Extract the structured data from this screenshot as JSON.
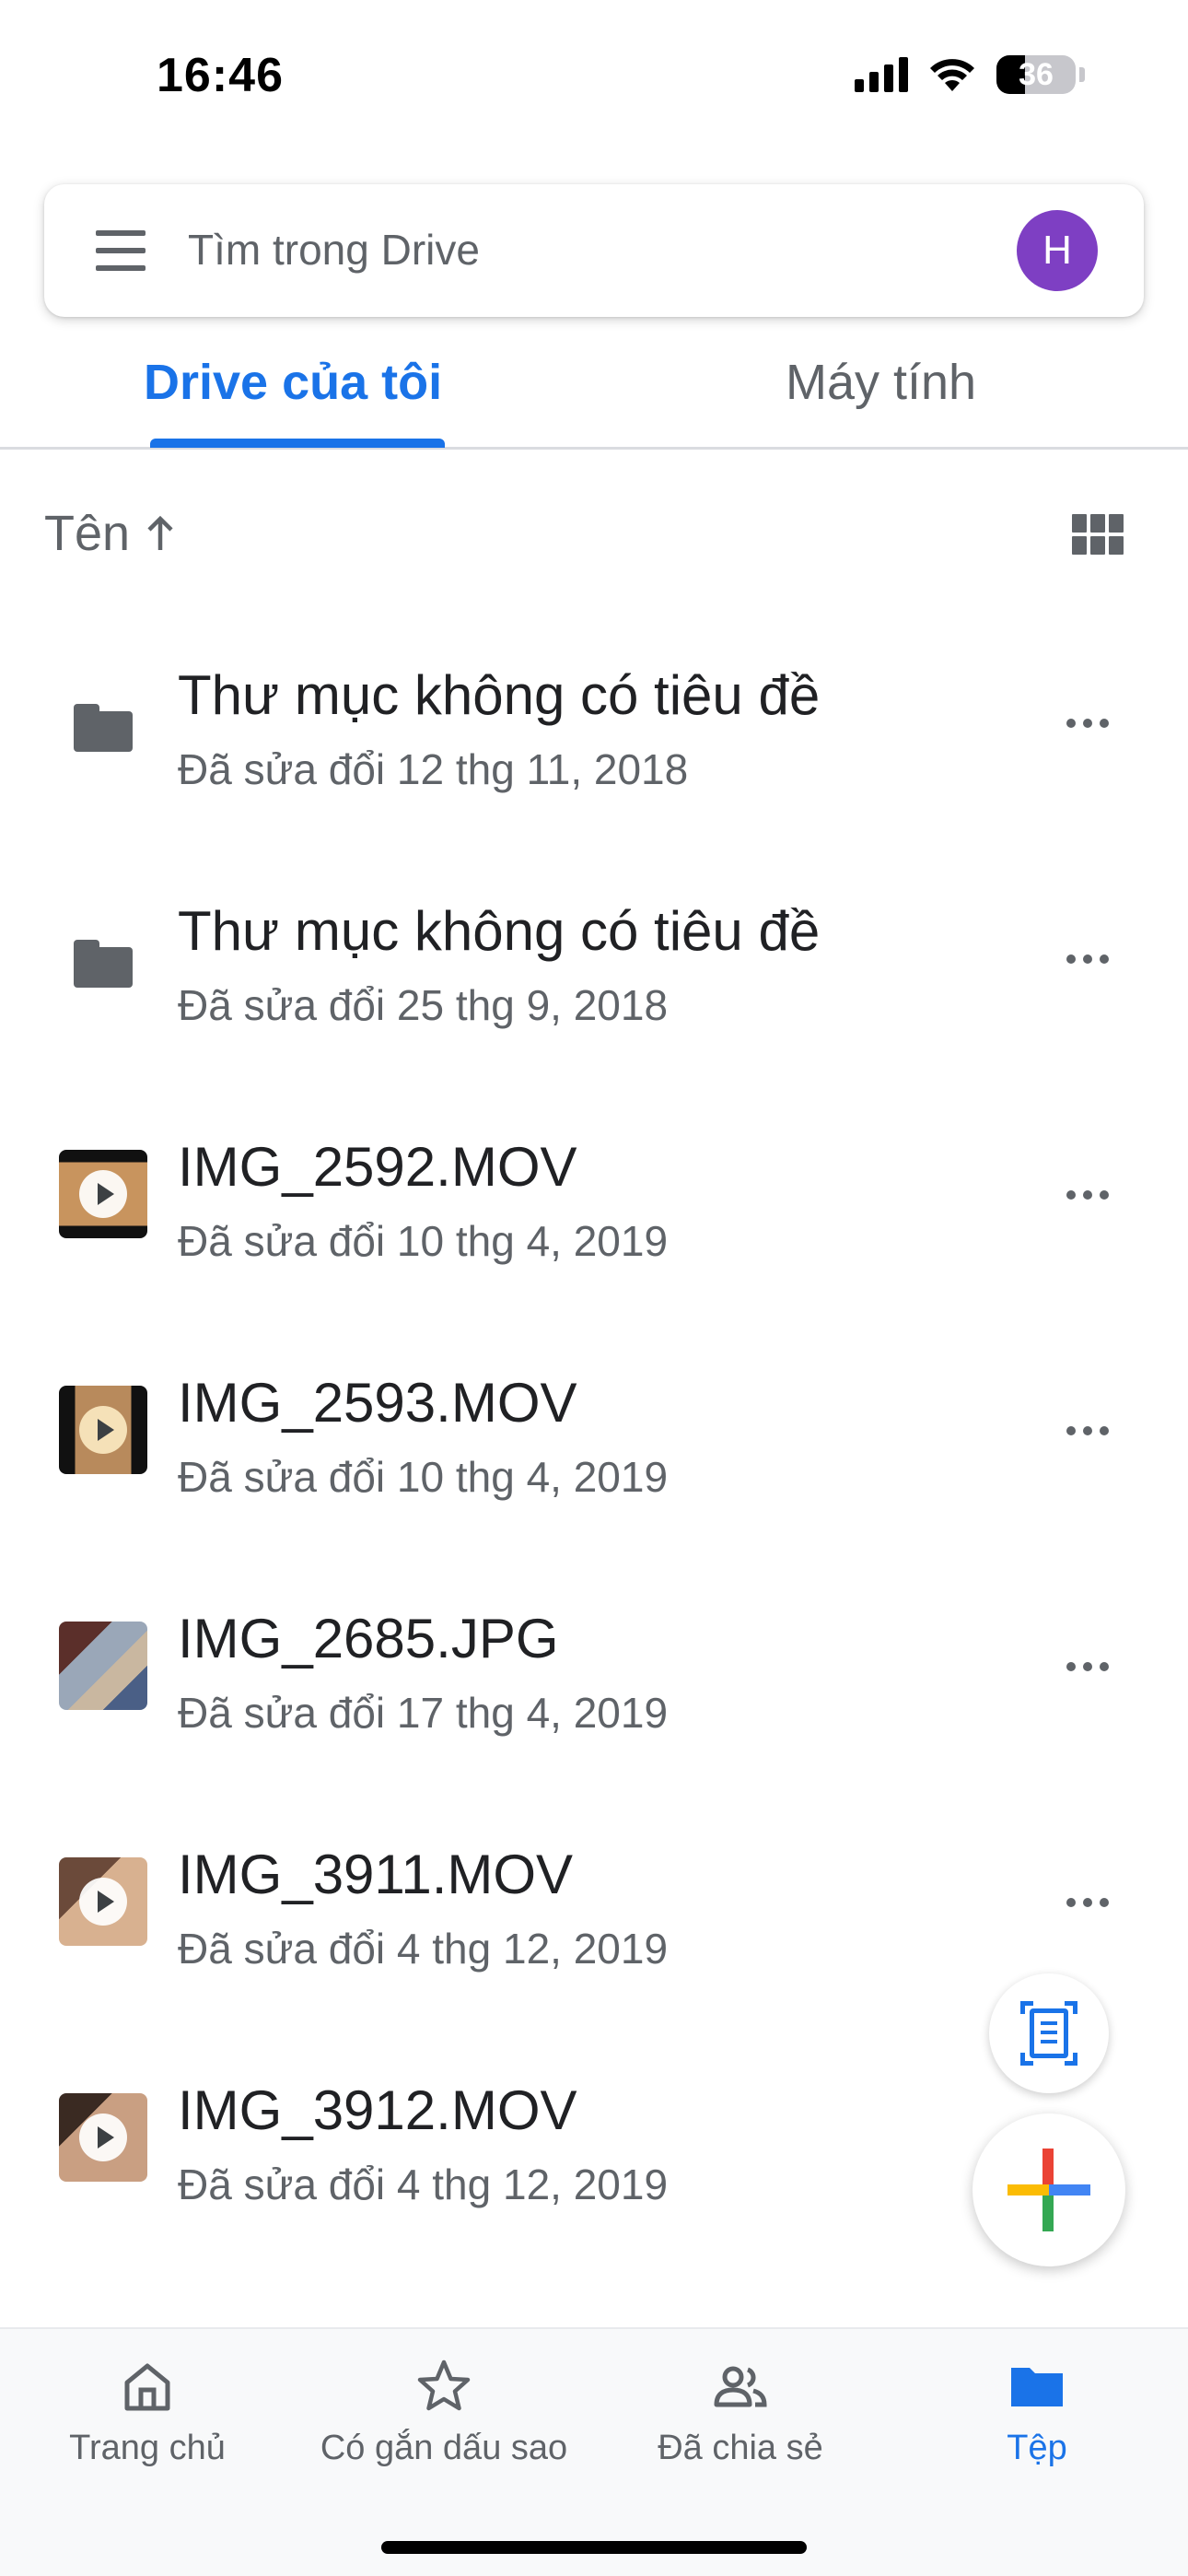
{
  "status_bar": {
    "time": "16:46",
    "battery": "36",
    "battery_level": 0.36
  },
  "search": {
    "placeholder": "Tìm trong Drive",
    "avatar_initial": "H",
    "avatar_color": "#7e3fc3"
  },
  "tabs": [
    {
      "label": "Drive của tôi",
      "active": true
    },
    {
      "label": "Máy tính",
      "active": false
    }
  ],
  "sort": {
    "label": "Tên",
    "direction_icon": "arrow-up-icon"
  },
  "view_toggle_icon": "grid-view-icon",
  "files": [
    {
      "name": "Thư mục không có tiêu đề",
      "meta": "Đã sửa đổi 12 thg 11, 2018",
      "type": "folder"
    },
    {
      "name": "Thư mục không có tiêu đề",
      "meta": "Đã sửa đổi 25 thg 9, 2018",
      "type": "folder"
    },
    {
      "name": "IMG_2592.MOV",
      "meta": "Đã sửa đổi 10 thg 4, 2019",
      "type": "video"
    },
    {
      "name": "IMG_2593.MOV",
      "meta": "Đã sửa đổi 10 thg 4, 2019",
      "type": "video"
    },
    {
      "name": "IMG_2685.JPG",
      "meta": "Đã sửa đổi 17 thg 4, 2019",
      "type": "image"
    },
    {
      "name": "IMG_3911.MOV",
      "meta": "Đã sửa đổi 4 thg 12, 2019",
      "type": "video"
    },
    {
      "name": "IMG_3912.MOV",
      "meta": "Đã sửa đổi 4 thg 12, 2019",
      "type": "video"
    }
  ],
  "bottom_nav": [
    {
      "label": "Trang chủ",
      "icon": "home-icon",
      "active": false
    },
    {
      "label": "Có gắn dấu sao",
      "icon": "star-icon",
      "active": false
    },
    {
      "label": "Đã chia sẻ",
      "icon": "shared-people-icon",
      "active": false
    },
    {
      "label": "Tệp",
      "icon": "folder-icon",
      "active": true
    }
  ],
  "colors": {
    "accent": "#1a73e8",
    "text_primary": "#202124",
    "text_secondary": "#5f6368"
  }
}
